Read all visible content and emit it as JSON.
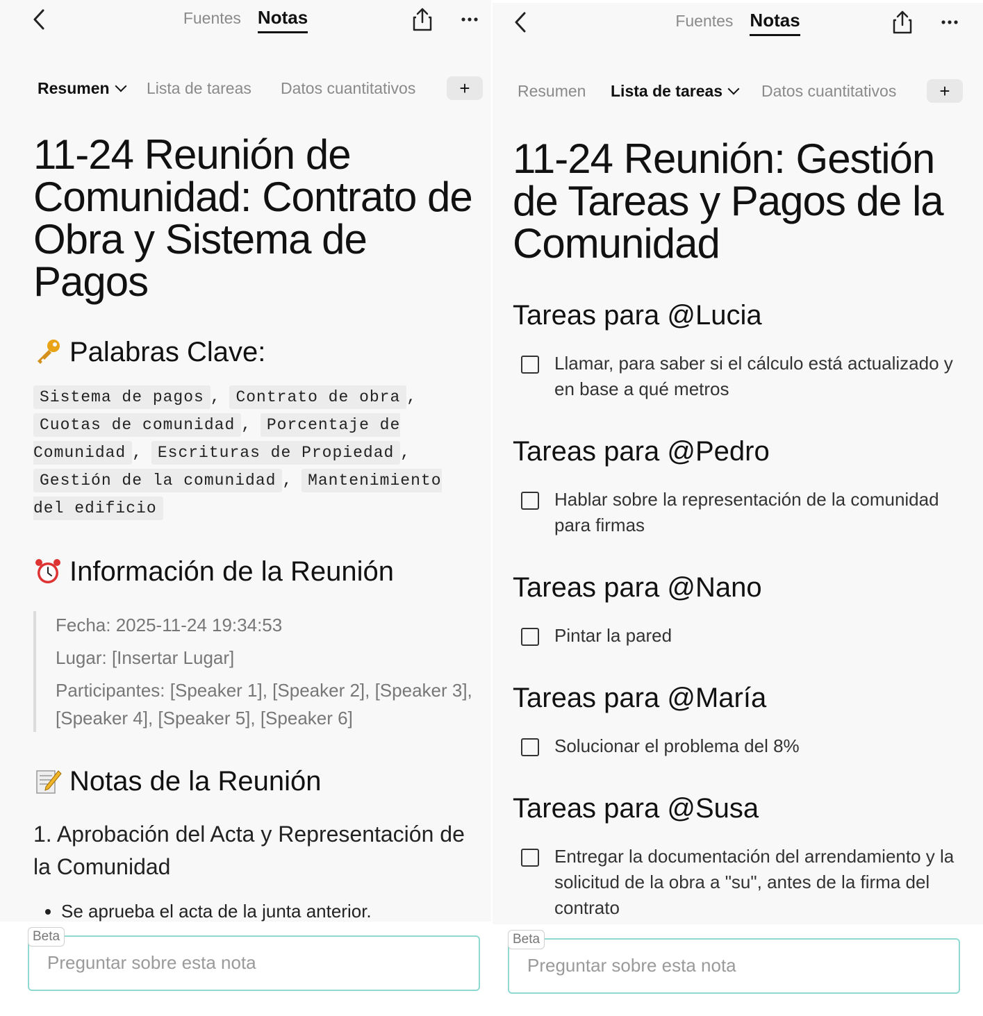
{
  "colors": {
    "accent_border": "#8fd9d2",
    "background": "#f8f8f8",
    "text": "#111111",
    "muted": "#8a8a8a"
  },
  "nav": {
    "tabs": [
      "Fuentes",
      "Notas"
    ],
    "active_tab": "Notas",
    "back_icon": "chevron-left-icon",
    "share_icon": "share-icon",
    "more_icon": "more-horizontal-icon"
  },
  "subtabs": [
    "Resumen",
    "Lista de tareas",
    "Datos cuantitativos"
  ],
  "plus_label": "+",
  "left": {
    "active_subtab": "Resumen",
    "title": "11-24 Reunión de Comunidad: Contrato de Obra y Sistema de Pagos",
    "keywords_heading": "Palabras Clave:",
    "keywords": [
      "Sistema de pagos",
      "Contrato de obra",
      "Cuotas de comunidad",
      "Porcentaje de Comunidad",
      "Escrituras de Propiedad",
      "Gestión de la comunidad",
      "Mantenimiento del edificio"
    ],
    "info_heading": "Información de la Reunión",
    "info": {
      "fecha": "Fecha: 2025-11-24 19:34:53",
      "lugar": "Lugar: [Insertar Lugar]",
      "participantes": "Participantes: [Speaker 1], [Speaker 2], [Speaker 3], [Speaker 4], [Speaker 5], [Speaker 6]"
    },
    "notes_heading": "Notas de la Reunión",
    "note_1_title": "1. Aprobación del Acta y Representación de la Comunidad",
    "note_1_bullets": [
      "Se aprueba el acta de la junta anterior."
    ]
  },
  "right": {
    "active_subtab": "Lista de tareas",
    "title": "11-24 Reunión: Gestión de Tareas y Pagos de la Comunidad",
    "task_groups": [
      {
        "heading": "Tareas para @Lucia",
        "task": "Llamar, para saber si el cálculo está actualizado y en base a qué metros"
      },
      {
        "heading": "Tareas para @Pedro",
        "task": "Hablar sobre la representación de la comunidad para firmas"
      },
      {
        "heading": "Tareas para @Nano",
        "task": "Pintar la pared"
      },
      {
        "heading": "Tareas para @María",
        "task": "Solucionar el problema del 8%"
      },
      {
        "heading": "Tareas para @Susa",
        "task": "Entregar la documentación del arrendamiento y la solicitud de la obra a \"su\", antes de la firma del contrato"
      }
    ]
  },
  "ask": {
    "badge": "Beta",
    "placeholder": "Preguntar sobre esta nota"
  }
}
